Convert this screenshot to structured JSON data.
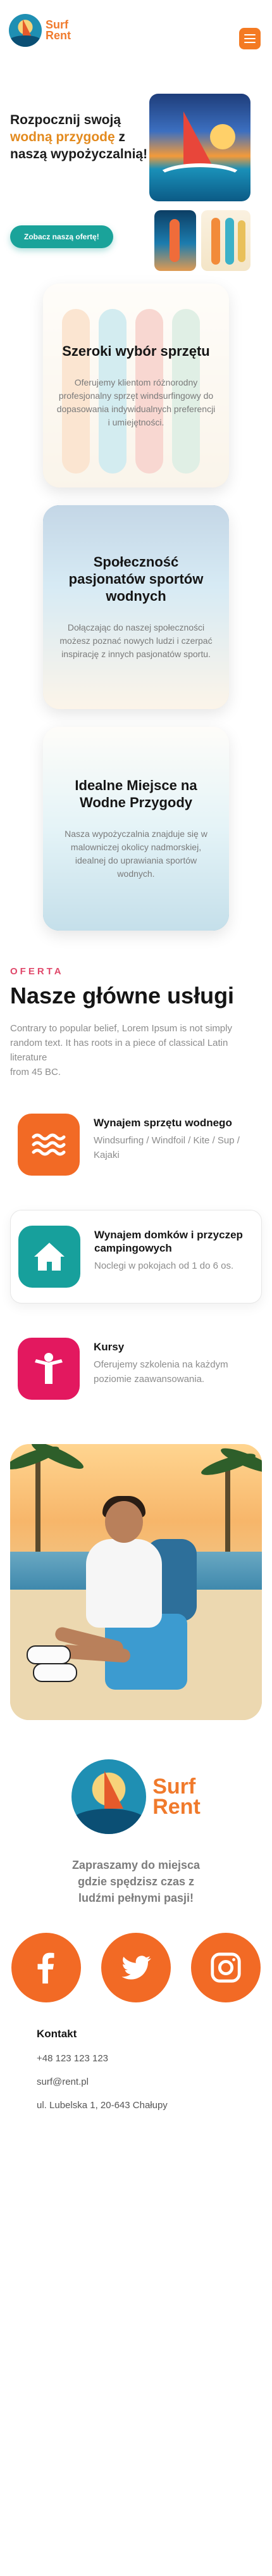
{
  "header": {
    "logo_line1": "Surf",
    "logo_line2": "Rent",
    "menu_icon": "hamburger-menu-icon"
  },
  "hero": {
    "title_part1": "Rozpocznij swoją ",
    "title_highlight": "wodną przygodę",
    "title_part2": " z naszą wypożyczalnią!",
    "button_label": "Zobacz naszą ofertę!"
  },
  "features": [
    {
      "title": "Szeroki wybór sprzętu",
      "text": "Oferujemy klientom różnorodny profesjonalny sprzęt windsurfingowy do dopasowania indywidualnych preferencji i umiejętności."
    },
    {
      "title": "Społeczność pasjonatów sportów wodnych",
      "text": "Dołączając do naszej społeczności możesz poznać nowych ludzi i czerpać inspirację z innych pasjonatów sportu."
    },
    {
      "title": "Idealne Miejsce na Wodne Przygody",
      "text": "Nasza wypożyczalnia znajduje się w malowniczej okolicy nadmorskiej, idealnej do uprawiania sportów wodnych."
    }
  ],
  "services": {
    "eyebrow": "OFERTA",
    "title": "Nasze główne usługi",
    "intro_line1": "Contrary to popular belief, Lorem Ipsum is not simply random text. It has roots in a piece of classical Latin literature",
    "intro_line2": "from 45 BC.",
    "items": [
      {
        "title": "Wynajem sprzętu wodnego",
        "desc": "Windsurfing / Windfoil / Kite / Sup / Kajaki",
        "icon": "waves-icon",
        "color": "#f26a25"
      },
      {
        "title": "Wynajem domków i przyczep campingowych",
        "desc": "Noclegi w pokojach od 1 do 6 os.",
        "icon": "house-icon",
        "color": "#17a09c"
      },
      {
        "title": "Kursy",
        "desc": "Oferujemy szkolenia na każdym poziomie zaawansowania.",
        "icon": "person-icon",
        "color": "#e3185f"
      }
    ]
  },
  "footer": {
    "logo_line1": "Surf",
    "logo_line2": "Rent",
    "tagline": "Zapraszamy do miejsca gdzie spędzisz czas z ludźmi pełnymi pasji!",
    "socials": [
      "facebook-icon",
      "twitter-icon",
      "instagram-icon"
    ],
    "contact_title": "Kontakt",
    "phone": "+48 123 123 123",
    "email": "surf@rent.pl",
    "address": "ul. Lubelska 1, 20-643 Chałupy"
  },
  "colors": {
    "brand_orange": "#f26a25",
    "teal": "#17a09c",
    "pink": "#e3185f",
    "highlight": "#e38a1e",
    "eyebrow": "#e0486a"
  }
}
